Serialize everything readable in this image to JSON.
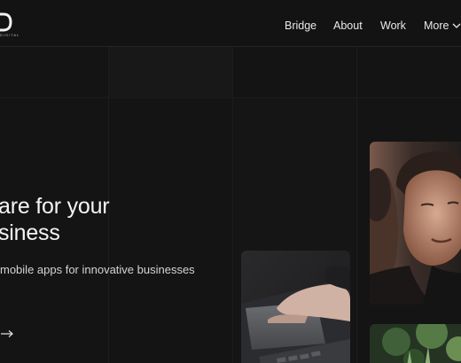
{
  "header": {
    "logo_glyph": "D",
    "logo_subtext": "DIGITAL",
    "nav": {
      "bridge": "Bridge",
      "about": "About",
      "work": "Work",
      "more": "More"
    }
  },
  "hero": {
    "title_line1": "are for your",
    "title_line2": "siness",
    "subtitle": "mobile apps for innovative businesses"
  },
  "images": {
    "laptop_photo": "laptop-hand-photo",
    "portrait_photo": "smiling-person-photo",
    "plant_photo": "plant-photo"
  },
  "colors": {
    "background": "#141414",
    "text": "#f2f2f2"
  }
}
